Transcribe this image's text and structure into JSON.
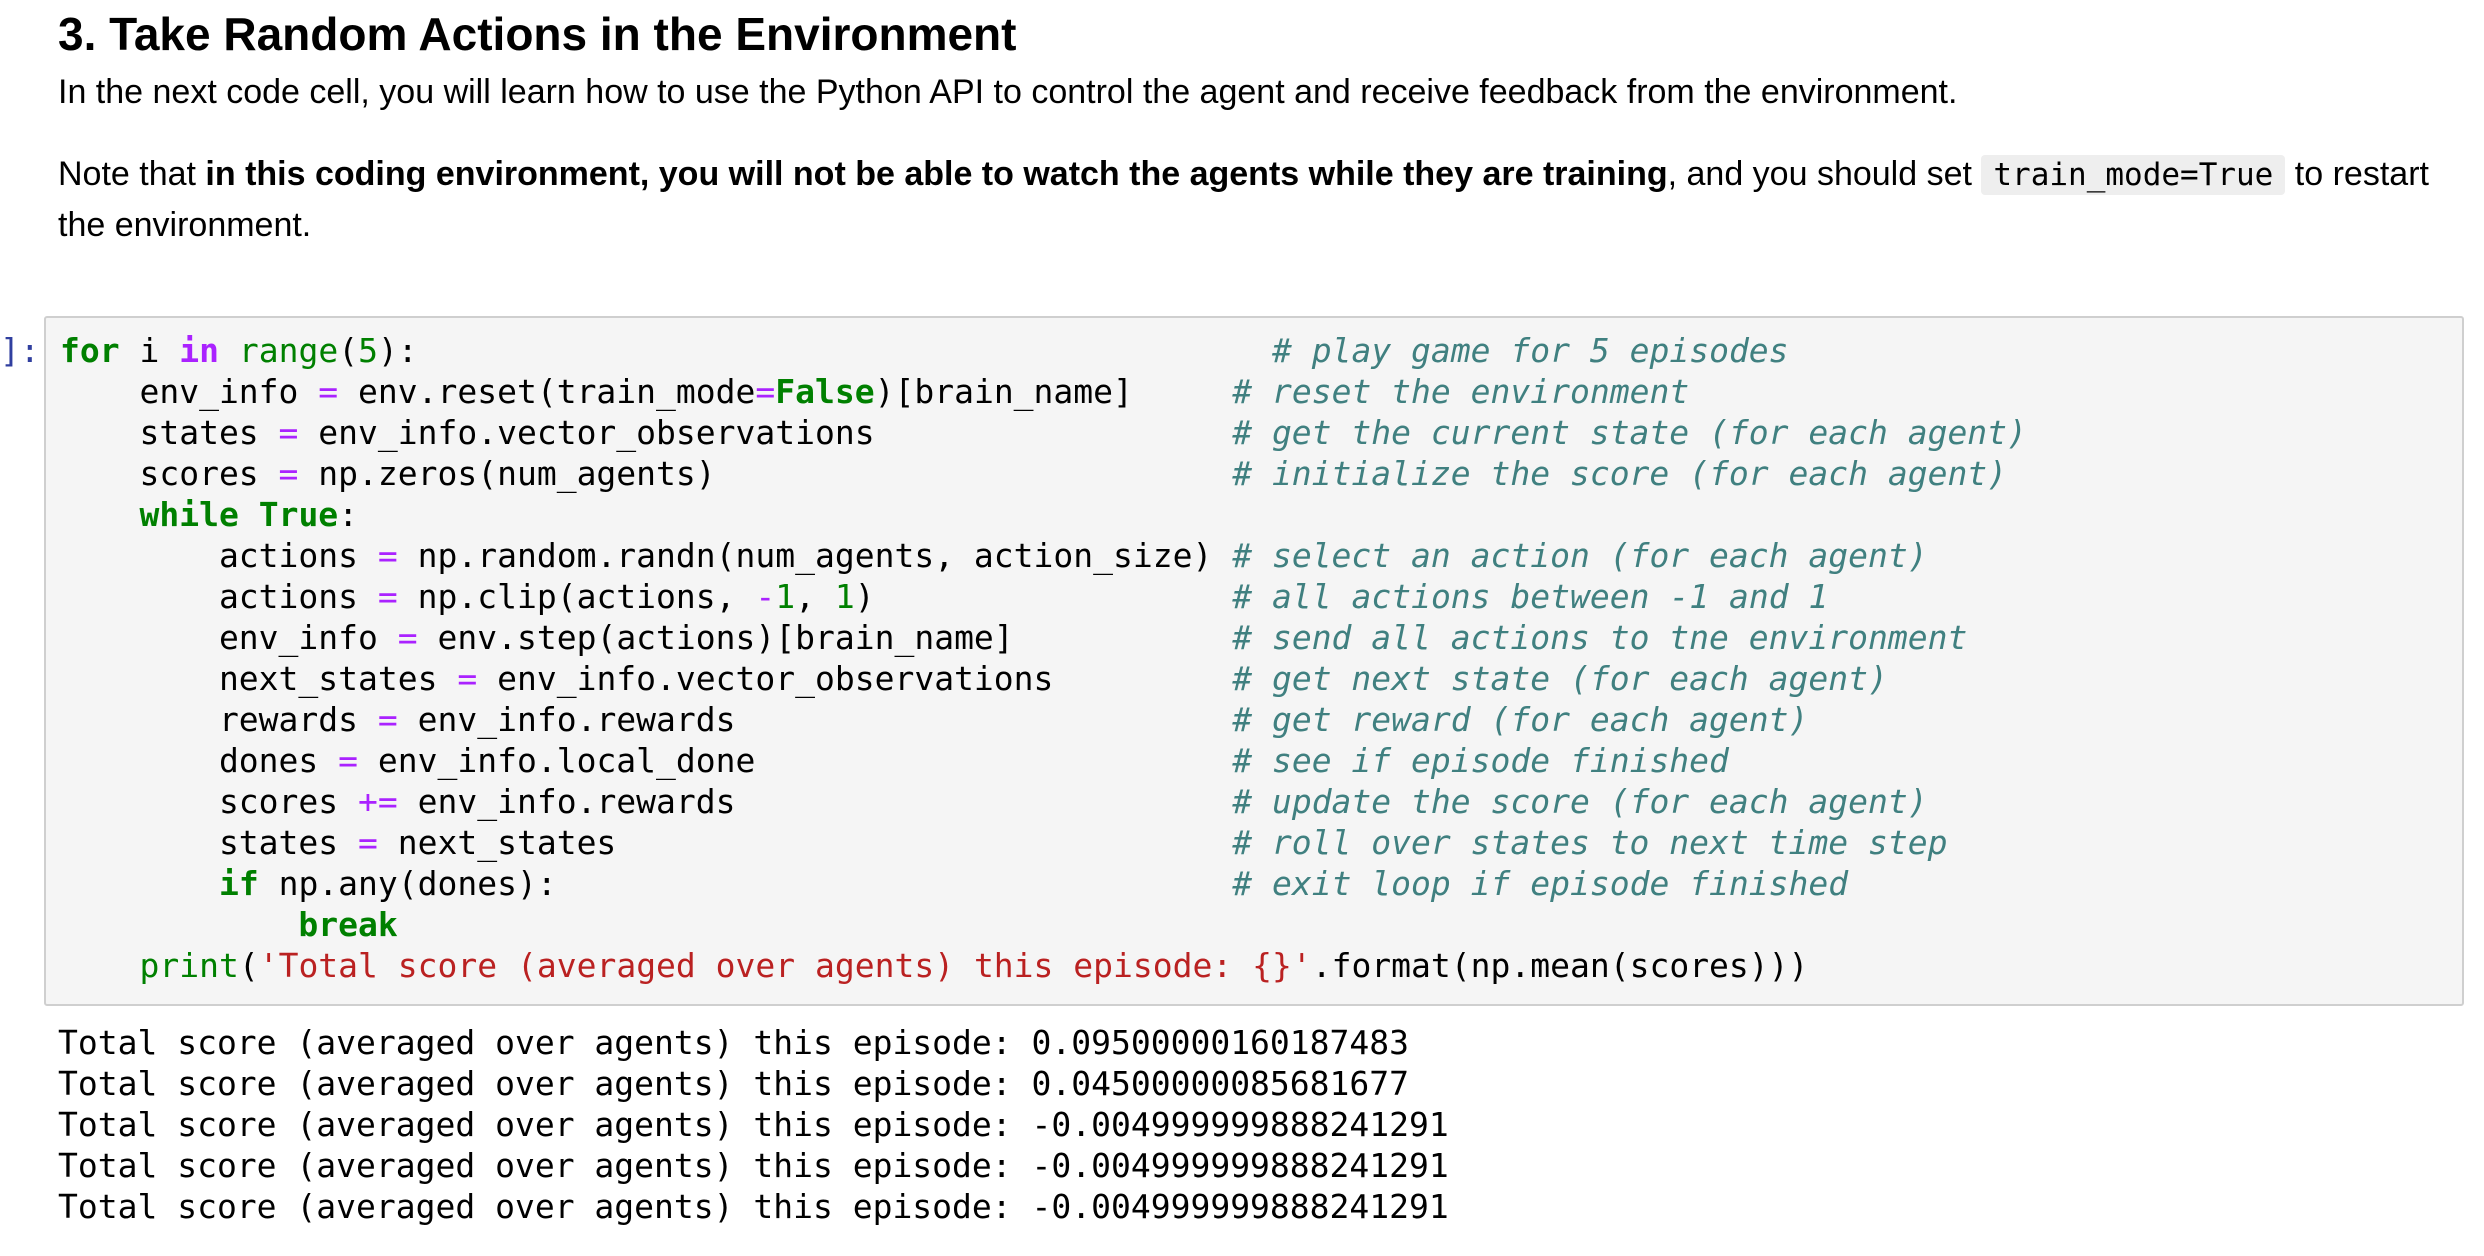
{
  "heading": "3. Take Random Actions in the Environment",
  "intro": "In the next code cell, you will learn how to use the Python API to control the agent and receive feedback from the environment.",
  "note": {
    "prefix": "Note that ",
    "bold": "in this coding environment, you will not be able to watch the agents while they are training",
    "middle": ", and you should set ",
    "code": "train_mode=True",
    "suffix": " to restart",
    "continuation": "the environment."
  },
  "cell": {
    "prompt": "]:",
    "code_lines": [
      [
        {
          "t": "k",
          "v": "for"
        },
        {
          "t": "",
          "v": " i "
        },
        {
          "t": "ow",
          "v": "in"
        },
        {
          "t": "",
          "v": " "
        },
        {
          "t": "nb",
          "v": "range"
        },
        {
          "t": "",
          "v": "("
        },
        {
          "t": "m",
          "v": "5"
        },
        {
          "t": "",
          "v": "):                                           "
        },
        {
          "t": "c",
          "v": "# play game for 5 episodes"
        }
      ],
      [
        {
          "t": "",
          "v": "    env_info "
        },
        {
          "t": "o",
          "v": "="
        },
        {
          "t": "",
          "v": " env.reset(train_mode"
        },
        {
          "t": "o",
          "v": "="
        },
        {
          "t": "k",
          "v": "False"
        },
        {
          "t": "",
          "v": ")[brain_name]     "
        },
        {
          "t": "c",
          "v": "# reset the environment"
        }
      ],
      [
        {
          "t": "",
          "v": "    states "
        },
        {
          "t": "o",
          "v": "="
        },
        {
          "t": "",
          "v": " env_info.vector_observations                  "
        },
        {
          "t": "c",
          "v": "# get the current state (for each agent)"
        }
      ],
      [
        {
          "t": "",
          "v": "    scores "
        },
        {
          "t": "o",
          "v": "="
        },
        {
          "t": "",
          "v": " np.zeros(num_agents)                          "
        },
        {
          "t": "c",
          "v": "# initialize the score (for each agent)"
        }
      ],
      [
        {
          "t": "",
          "v": "    "
        },
        {
          "t": "k",
          "v": "while"
        },
        {
          "t": "",
          "v": " "
        },
        {
          "t": "k",
          "v": "True"
        },
        {
          "t": "",
          "v": ":"
        }
      ],
      [
        {
          "t": "",
          "v": "        actions "
        },
        {
          "t": "o",
          "v": "="
        },
        {
          "t": "",
          "v": " np.random.randn(num_agents, action_size) "
        },
        {
          "t": "c",
          "v": "# select an action (for each agent)"
        }
      ],
      [
        {
          "t": "",
          "v": "        actions "
        },
        {
          "t": "o",
          "v": "="
        },
        {
          "t": "",
          "v": " np.clip(actions, "
        },
        {
          "t": "o",
          "v": "-"
        },
        {
          "t": "m",
          "v": "1"
        },
        {
          "t": "",
          "v": ", "
        },
        {
          "t": "m",
          "v": "1"
        },
        {
          "t": "",
          "v": ")                  "
        },
        {
          "t": "c",
          "v": "# all actions between -1 and 1"
        }
      ],
      [
        {
          "t": "",
          "v": "        env_info "
        },
        {
          "t": "o",
          "v": "="
        },
        {
          "t": "",
          "v": " env.step(actions)[brain_name]           "
        },
        {
          "t": "c",
          "v": "# send all actions to tne environment"
        }
      ],
      [
        {
          "t": "",
          "v": "        next_states "
        },
        {
          "t": "o",
          "v": "="
        },
        {
          "t": "",
          "v": " env_info.vector_observations         "
        },
        {
          "t": "c",
          "v": "# get next state (for each agent)"
        }
      ],
      [
        {
          "t": "",
          "v": "        rewards "
        },
        {
          "t": "o",
          "v": "="
        },
        {
          "t": "",
          "v": " env_info.rewards                         "
        },
        {
          "t": "c",
          "v": "# get reward (for each agent)"
        }
      ],
      [
        {
          "t": "",
          "v": "        dones "
        },
        {
          "t": "o",
          "v": "="
        },
        {
          "t": "",
          "v": " env_info.local_done                        "
        },
        {
          "t": "c",
          "v": "# see if episode finished"
        }
      ],
      [
        {
          "t": "",
          "v": "        scores "
        },
        {
          "t": "o",
          "v": "+="
        },
        {
          "t": "",
          "v": " env_info.rewards                         "
        },
        {
          "t": "c",
          "v": "# update the score (for each agent)"
        }
      ],
      [
        {
          "t": "",
          "v": "        states "
        },
        {
          "t": "o",
          "v": "="
        },
        {
          "t": "",
          "v": " next_states                               "
        },
        {
          "t": "c",
          "v": "# roll over states to next time step"
        }
      ],
      [
        {
          "t": "",
          "v": "        "
        },
        {
          "t": "k",
          "v": "if"
        },
        {
          "t": "",
          "v": " np.any(dones):                                  "
        },
        {
          "t": "c",
          "v": "# exit loop if episode finished"
        }
      ],
      [
        {
          "t": "",
          "v": "            "
        },
        {
          "t": "k",
          "v": "break"
        }
      ],
      [
        {
          "t": "",
          "v": "    "
        },
        {
          "t": "nb",
          "v": "print"
        },
        {
          "t": "",
          "v": "("
        },
        {
          "t": "s",
          "v": "'Total score (averaged over agents) this episode: {}'"
        },
        {
          "t": "",
          "v": ".format(np.mean(scores)))"
        }
      ]
    ]
  },
  "output_lines": [
    "Total score (averaged over agents) this episode: 0.09500000160187483",
    "Total score (averaged over agents) this episode: 0.04500000085681677",
    "Total score (averaged over agents) this episode: -0.004999999888241291",
    "Total score (averaged over agents) this episode: -0.004999999888241291",
    "Total score (averaged over agents) this episode: -0.004999999888241291"
  ]
}
